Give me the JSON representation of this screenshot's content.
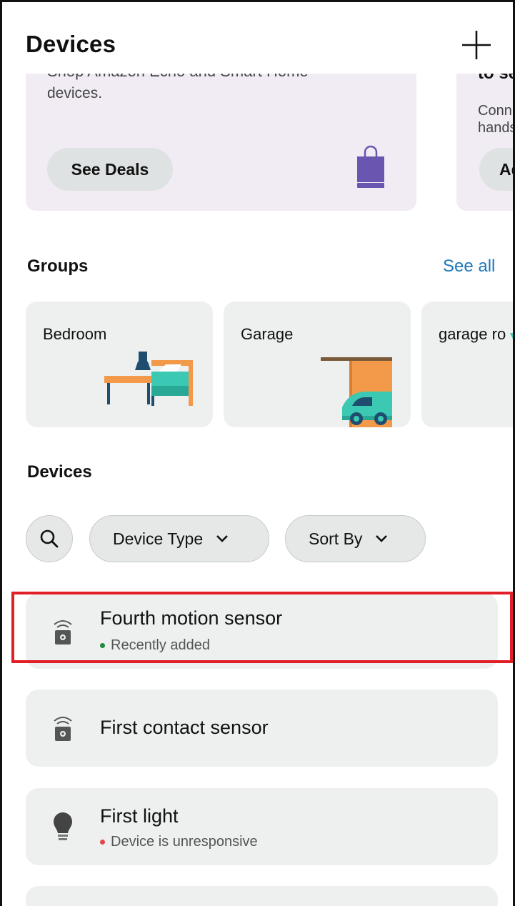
{
  "header": {
    "title": "Devices",
    "add_icon": "plus-icon"
  },
  "promos": [
    {
      "cut_text": "Shop Amazon Echo and Smart Home",
      "text": "devices.",
      "button_label": "See Deals",
      "icon": "shopping-bag-icon",
      "icon_color": "#6a55b1"
    },
    {
      "heading_partial": "to se",
      "text_line1": "Conn",
      "text_line2": "hands",
      "button_label": "Ad"
    }
  ],
  "groups_section": {
    "title": "Groups",
    "see_all_label": "See all",
    "items": [
      {
        "label": "Bedroom",
        "icon": "bedroom-illustration"
      },
      {
        "label": "Garage",
        "icon": "garage-illustration"
      },
      {
        "label": "garage ro",
        "icon": "room-illustration"
      }
    ]
  },
  "devices_section": {
    "title": "Devices",
    "search_icon": "search-icon",
    "filters": [
      {
        "label": "Device Type",
        "icon": "chevron-down-icon"
      },
      {
        "label": "Sort By",
        "icon": "chevron-down-icon"
      }
    ],
    "items": [
      {
        "name": "Fourth motion sensor",
        "status": "Recently added",
        "status_color": "#1f8a3c",
        "icon": "sensor-icon",
        "highlighted": true
      },
      {
        "name": "First contact sensor",
        "status": "",
        "icon": "sensor-icon"
      },
      {
        "name": "First light",
        "status": "Device is unresponsive",
        "status_color": "#e0454b",
        "icon": "lightbulb-icon"
      }
    ]
  },
  "colors": {
    "accent_link": "#1b79b9",
    "card_bg": "#eef0f0",
    "promo_bg": "#f1ecf4",
    "highlight_border": "#e01f26"
  }
}
